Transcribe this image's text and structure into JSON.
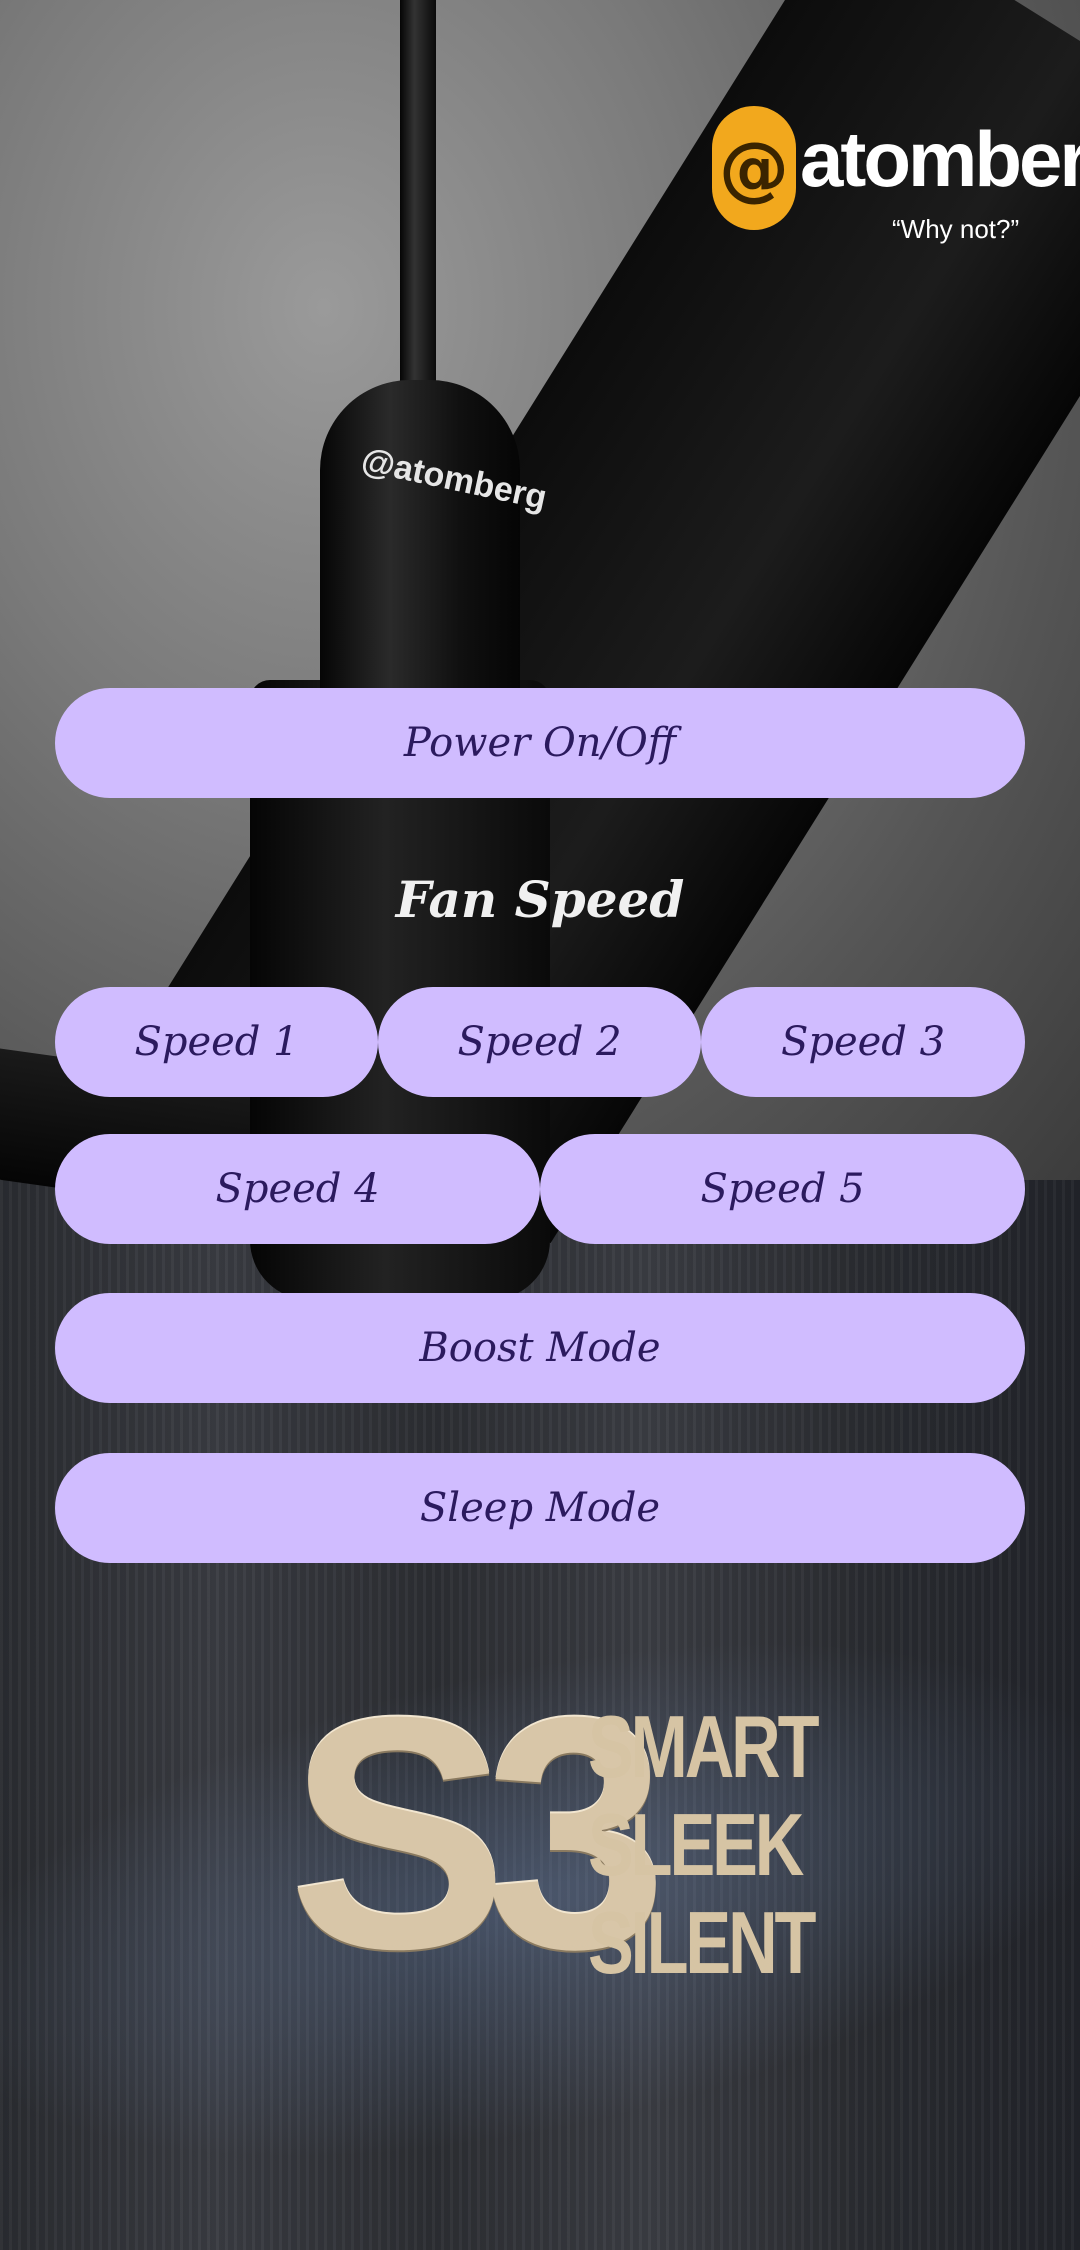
{
  "brand": {
    "logo_mark": "@",
    "name": "atomberg",
    "tagline": "“Why not?”",
    "canopy_label": "@atomberg",
    "accent": "#f2a81d"
  },
  "controls": {
    "power_label": "Power On/Off",
    "fan_speed_title": "Fan Speed",
    "speeds": [
      "Speed 1",
      "Speed 2",
      "Speed 3",
      "Speed 4",
      "Speed 5"
    ],
    "boost_label": "Boost Mode",
    "sleep_label": "Sleep Mode",
    "button_color": "#d0bcff",
    "button_text_color": "#2b1a5e"
  },
  "badge": {
    "model": "S3",
    "words": [
      "SMART",
      "SLEEK",
      "SILENT"
    ]
  }
}
